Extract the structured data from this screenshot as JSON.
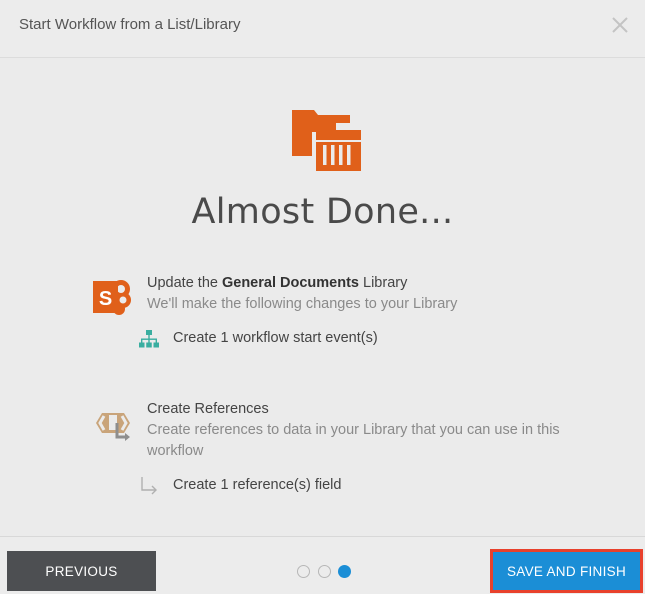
{
  "header": {
    "title": "Start Workflow from a List/Library"
  },
  "main": {
    "heading": "Almost Done...",
    "sections": [
      {
        "icon": "sharepoint-icon",
        "title_prefix": "Update the ",
        "title_bold": "General Documents",
        "title_suffix": " Library",
        "subtitle": "We'll make the following changes to your Library",
        "change_icon": "hierarchy-icon",
        "change": "Create 1 workflow start event(s)"
      },
      {
        "icon": "references-icon",
        "title": "Create References",
        "subtitle": "Create references to data in your Library that you can use in this workflow",
        "change_icon": "arrow-return-icon",
        "change": "Create 1 reference(s) field"
      }
    ]
  },
  "footer": {
    "previous_label": "PREVIOUS",
    "save_label": "SAVE AND FINISH",
    "steps": {
      "total": 3,
      "current": 3
    }
  },
  "colors": {
    "accent": "#1b8ed6",
    "sharepoint_orange": "#e0601a",
    "highlight_border": "#e8412c"
  }
}
